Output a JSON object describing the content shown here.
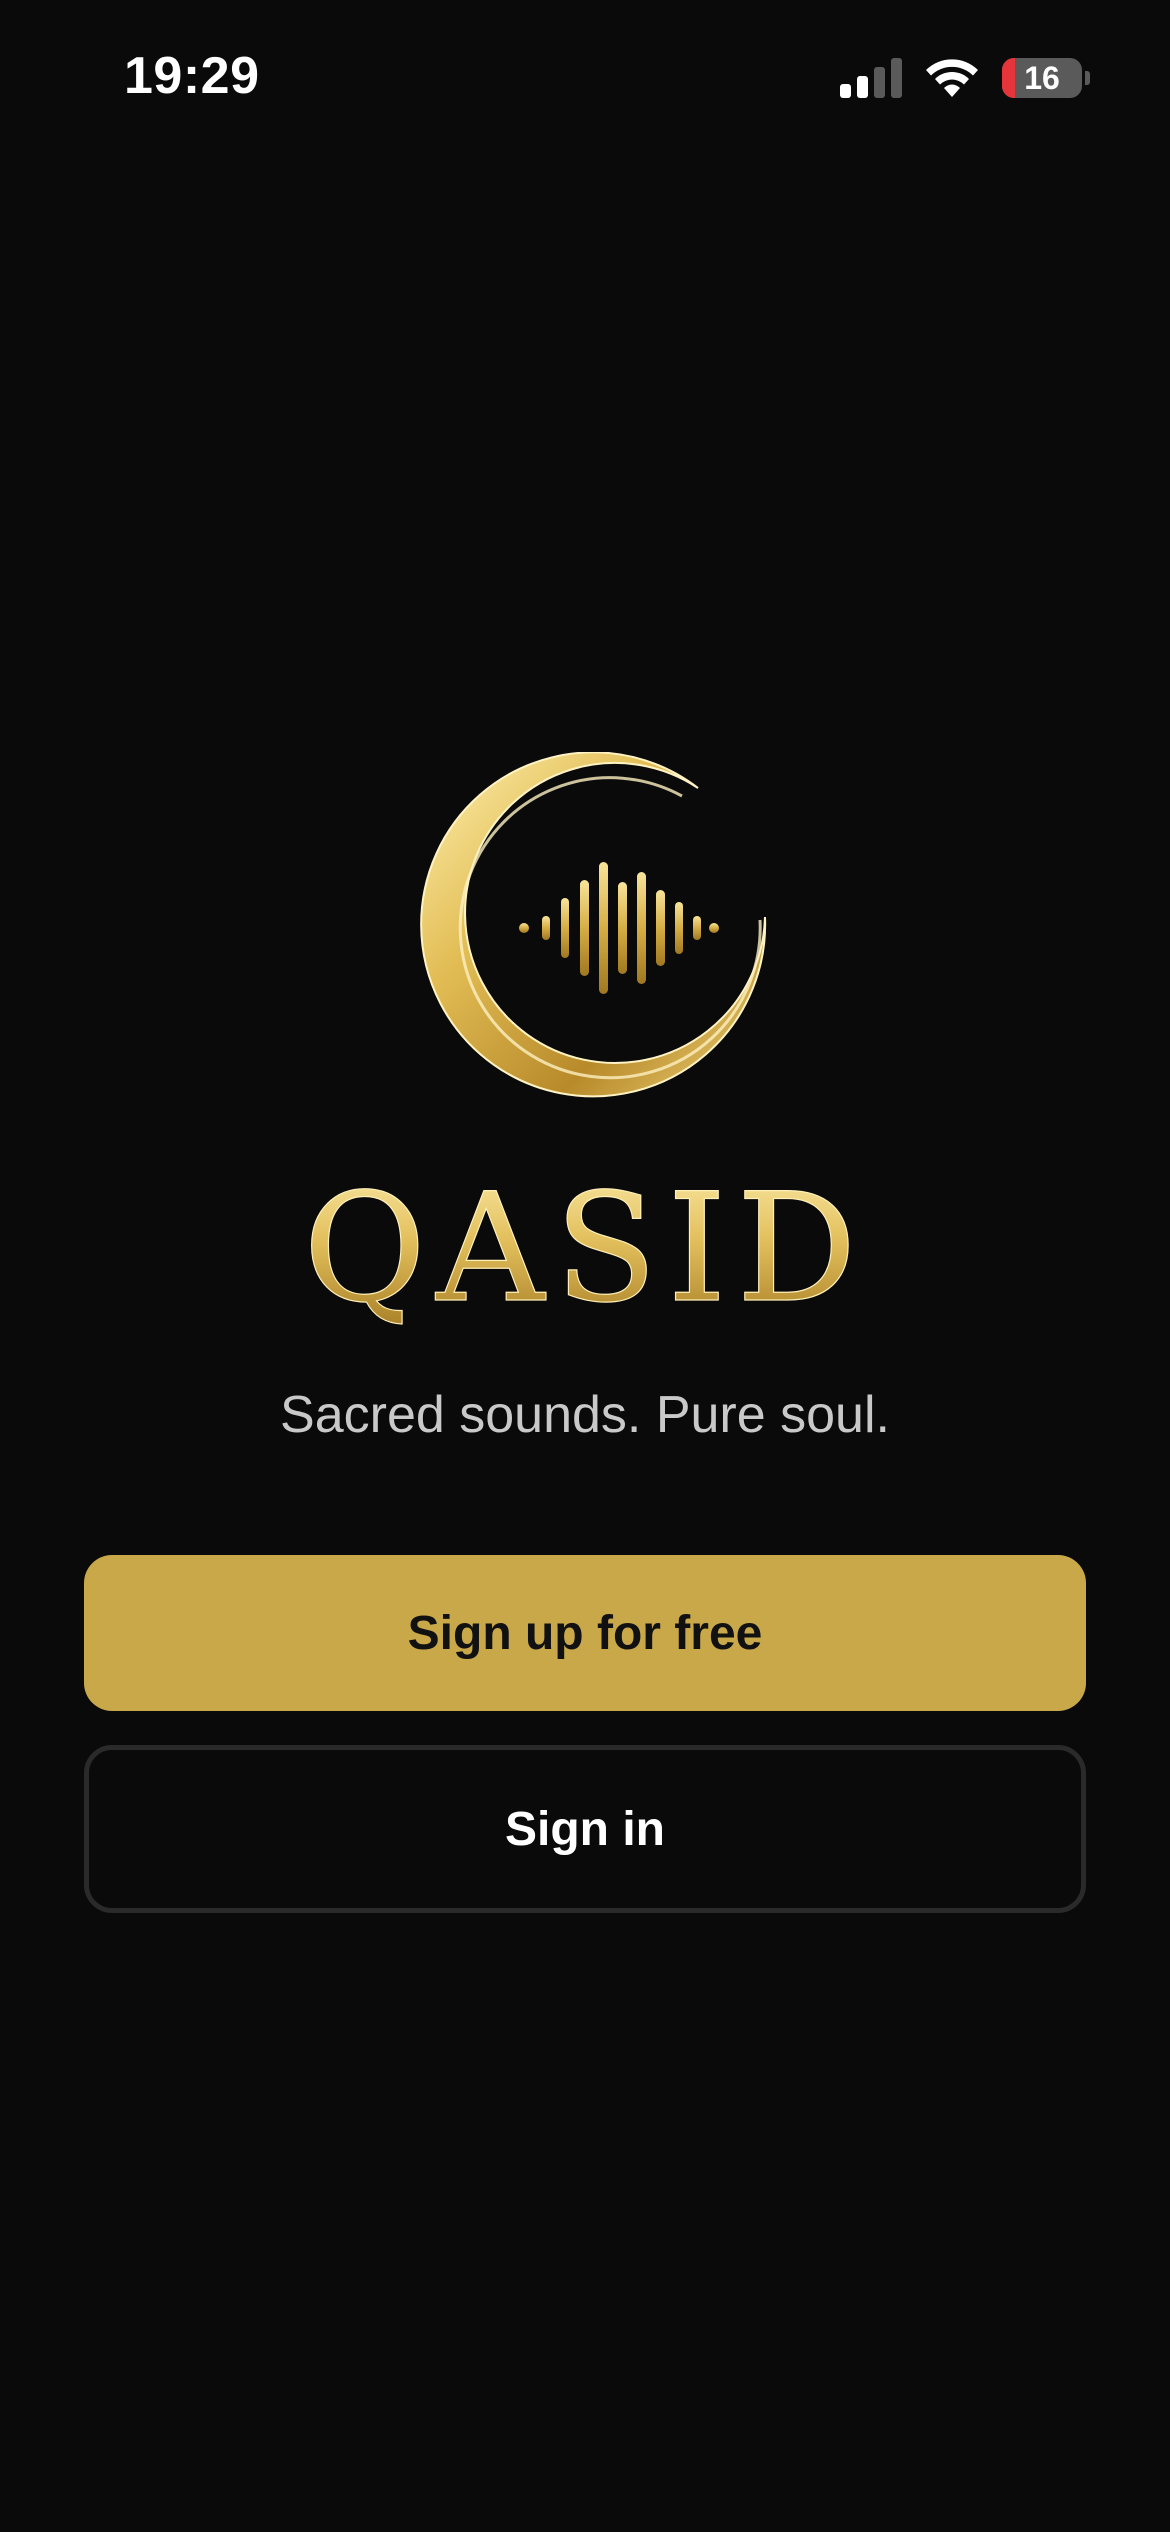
{
  "status_bar": {
    "time": "19:29",
    "battery_level": "16",
    "battery_fraction": 0.16,
    "signal_bars_active": 2,
    "signal_bars_total": 4,
    "icons": [
      "cellular-signal-icon",
      "wifi-icon",
      "battery-icon"
    ]
  },
  "brand": {
    "name": "QASID",
    "tagline": "Sacred sounds. Pure soul.",
    "logo_icon": "crescent-soundwave-logo",
    "gold_light": "#f6e39a",
    "gold_mid": "#d4ad48",
    "gold_dark": "#8a6418"
  },
  "actions": {
    "signup_label": "Sign up for free",
    "signin_label": "Sign in"
  },
  "colors": {
    "background": "#0a0a0a",
    "signup_button": "#c9a84a",
    "signin_border": "#2a2a2a",
    "tagline": "#c9c9c9",
    "battery_low": "#e5343a"
  }
}
